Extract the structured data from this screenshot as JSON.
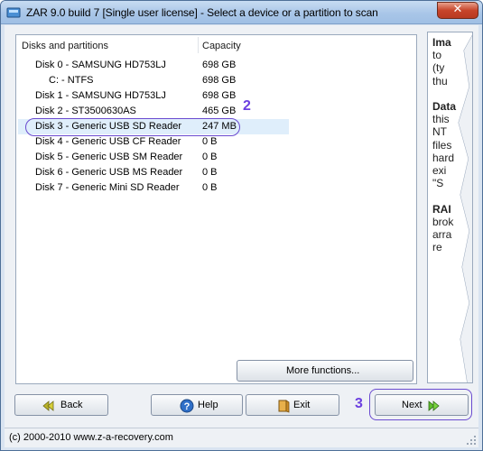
{
  "window": {
    "title": "ZAR 9.0 build 7 [Single user license] - Select a device or a partition to scan",
    "close_glyph": "✕"
  },
  "list": {
    "columns": [
      "Disks and partitions",
      "Capacity"
    ],
    "rows": [
      {
        "name": "Disk 0 - SAMSUNG HD753LJ",
        "capacity": "698 GB",
        "indent": 0
      },
      {
        "name": "C: - NTFS",
        "capacity": "698 GB",
        "indent": 1
      },
      {
        "name": "Disk 1 - SAMSUNG HD753LJ",
        "capacity": "698 GB",
        "indent": 0
      },
      {
        "name": "Disk 2 - ST3500630AS",
        "capacity": "465 GB",
        "indent": 0
      },
      {
        "name": "Disk 3 - Generic USB SD Reader",
        "capacity": "247 MB",
        "indent": 0,
        "selected": true
      },
      {
        "name": "Disk 4 - Generic USB CF Reader",
        "capacity": "0 B",
        "indent": 0
      },
      {
        "name": "Disk 5 - Generic USB SM Reader",
        "capacity": "0 B",
        "indent": 0
      },
      {
        "name": "Disk 6 - Generic USB MS Reader",
        "capacity": "0 B",
        "indent": 0
      },
      {
        "name": "Disk 7 - Generic Mini SD Reader",
        "capacity": "0 B",
        "indent": 0
      }
    ]
  },
  "annotations": {
    "step_select": "2",
    "step_next": "3"
  },
  "buttons": {
    "more_functions": "More functions...",
    "back": "Back",
    "help": "Help",
    "exit": "Exit",
    "next": "Next"
  },
  "help_panel": {
    "lines": [
      "Ima",
      "to",
      "(ty",
      "thu",
      "",
      "Data",
      "this",
      "NT",
      "files",
      "hard",
      "exi",
      "\"S",
      "",
      "RAI",
      "brok",
      "arra",
      "re"
    ],
    "bold_lines": [
      0,
      5,
      13
    ]
  },
  "status": {
    "text": "(c) 2000-2010 www.z-a-recovery.com"
  },
  "colors": {
    "annotation": "#6b3fe0",
    "selected_row": "#dfeefb",
    "titlebar": "#a9c6e8"
  }
}
